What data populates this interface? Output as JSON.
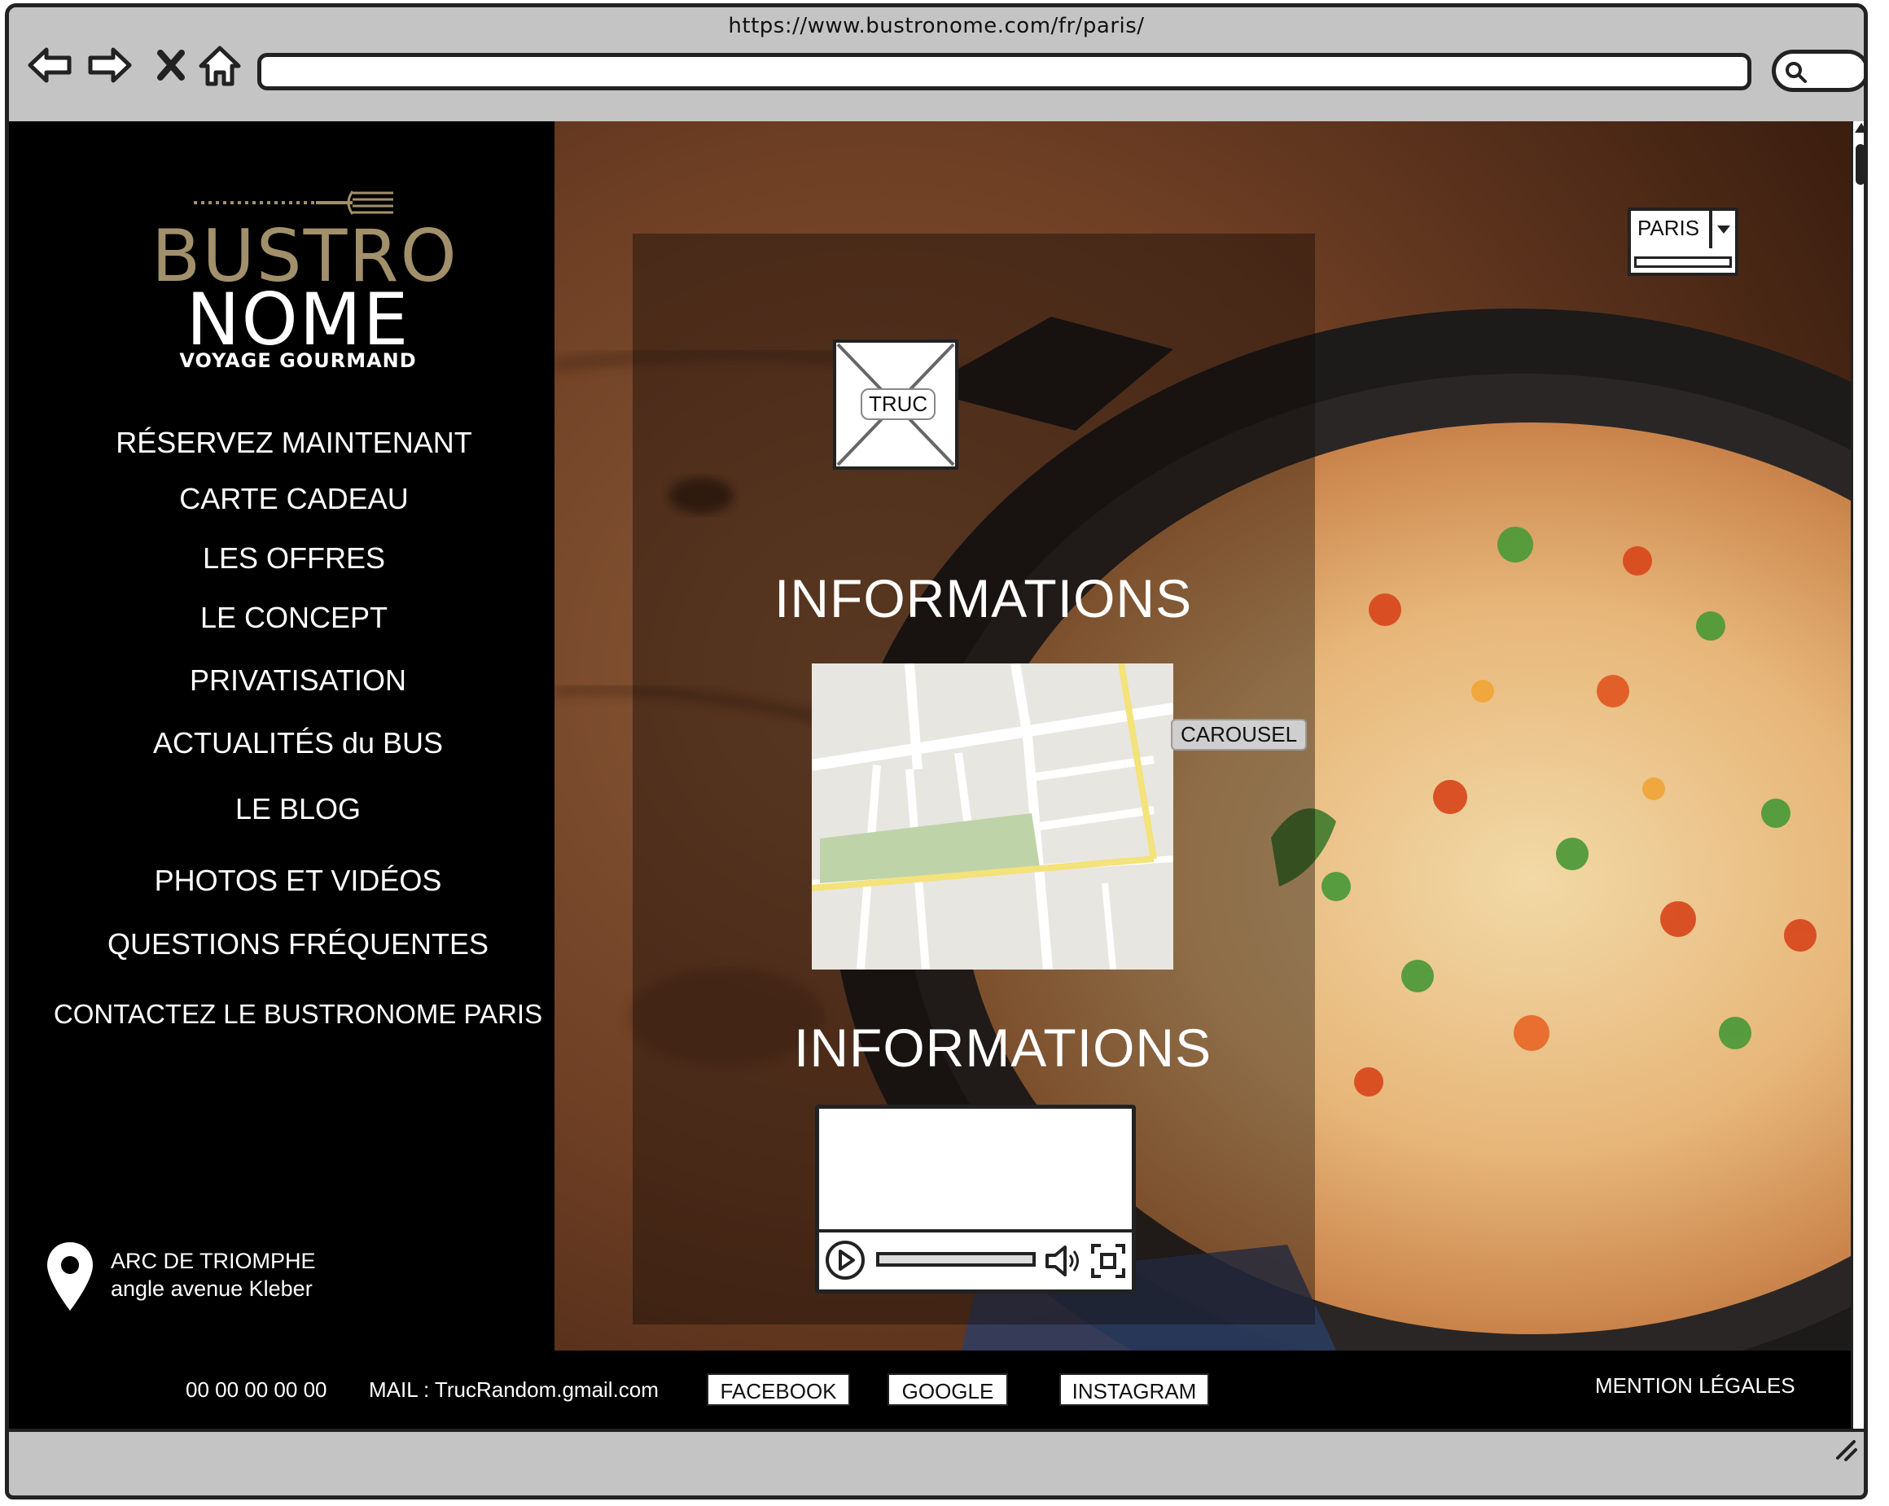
{
  "browser": {
    "url": "https://www.bustronome.com/fr/paris/",
    "icons": [
      "back-arrow-icon",
      "forward-arrow-icon",
      "close-icon",
      "home-icon",
      "search-icon"
    ]
  },
  "logo": {
    "line1": "BUSTRO",
    "line2": "NOME",
    "tagline": "VOYAGE GOURMAND",
    "colors": {
      "gold": "#a2906b",
      "white": "#ffffff"
    }
  },
  "menu": [
    {
      "label": "RÉSERVEZ MAINTENANT"
    },
    {
      "label": "CARTE CADEAU"
    },
    {
      "label": "LES OFFRES"
    },
    {
      "label": "LE CONCEPT"
    },
    {
      "label": "PRIVATISATION"
    },
    {
      "label": "ACTUALITÉS du BUS"
    },
    {
      "label": "LE BLOG"
    },
    {
      "label": "PHOTOS ET VIDÉOS"
    },
    {
      "label": "QUESTIONS FRÉQUENTES"
    },
    {
      "label": "CONTACTEZ LE BUSTRONOME PARIS"
    }
  ],
  "address": {
    "line1": "ARC DE TRIOMPHE",
    "line2": "angle avenue Kleber"
  },
  "main": {
    "image_placeholder_label": "TRUC",
    "info_title_1": "INFORMATIONS",
    "info_title_2": "INFORMATIONS",
    "carousel_label": "CAROUSEL",
    "city_select": {
      "value": "PARIS"
    }
  },
  "footer": {
    "phone": "00 00 00 00 00",
    "mail": "MAIL : TrucRandom.gmail.com",
    "facebook": "FACEBOOK",
    "google": "GOOGLE",
    "instagram": "INSTAGRAM",
    "legal": "MENTION LÉGALES"
  }
}
